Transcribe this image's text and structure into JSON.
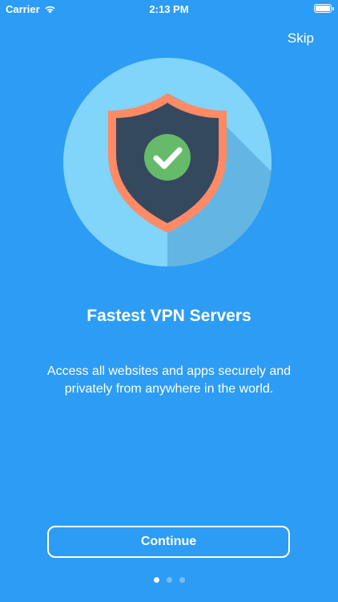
{
  "status_bar": {
    "carrier": "Carrier",
    "time": "2:13 PM",
    "icons": [
      "wifi-icon",
      "battery-icon"
    ]
  },
  "onboarding": {
    "skip_label": "Skip",
    "illustration": "shield-check-icon",
    "title": "Fastest VPN Servers",
    "description": "Access all websites and apps securely and privately from anywhere in the world.",
    "continue_label": "Continue",
    "page_indicator": {
      "total": 3,
      "current": 1
    }
  },
  "colors": {
    "background": "#2d9cf4",
    "circle": "#81d4fa",
    "shield_border": "#ff8a65",
    "shield_body": "#34495e",
    "check_badge": "#66bb6a"
  }
}
